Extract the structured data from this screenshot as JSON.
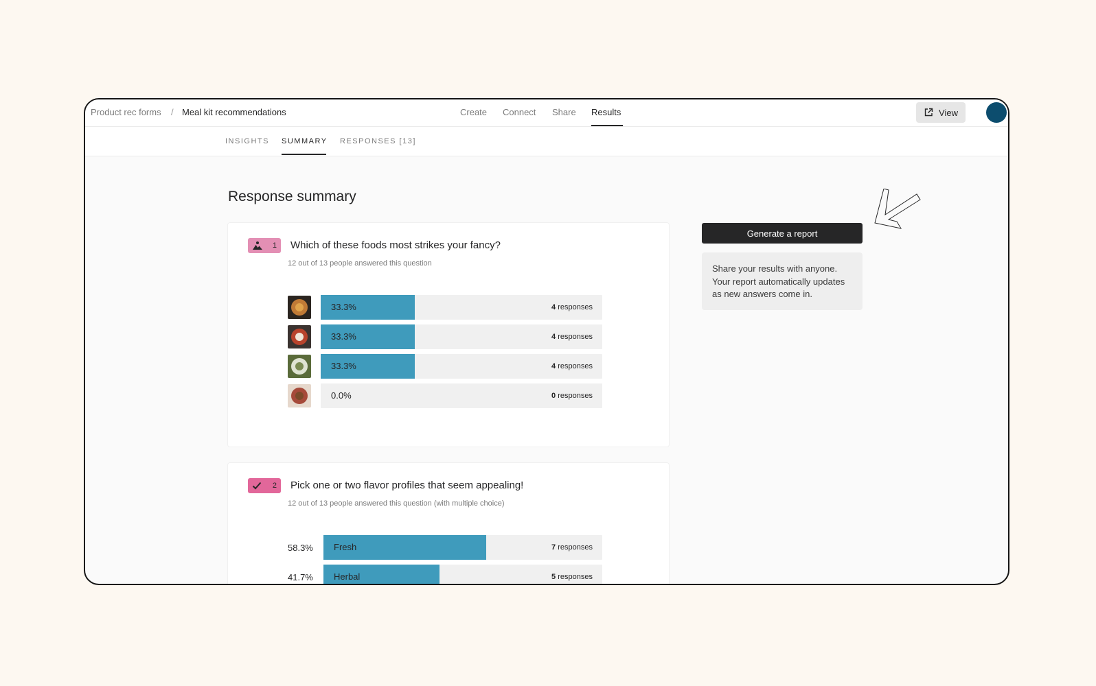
{
  "breadcrumb": {
    "parent": "Product rec forms",
    "separator": "/",
    "current": "Meal kit recommendations"
  },
  "nav_tabs": [
    {
      "label": "Create",
      "active": false
    },
    {
      "label": "Connect",
      "active": false
    },
    {
      "label": "Share",
      "active": false
    },
    {
      "label": "Results",
      "active": true
    }
  ],
  "view_button": {
    "label": "View",
    "icon": "external-link-icon"
  },
  "avatar": {
    "color": "#0c4d6e"
  },
  "sub_tabs": [
    {
      "label": "INSIGHTS",
      "active": false
    },
    {
      "label": "SUMMARY",
      "active": true
    },
    {
      "label": "RESPONSES [13]",
      "active": false
    }
  ],
  "page_title": "Response summary",
  "questions": [
    {
      "number": "1",
      "icon": "picture-choice-icon",
      "badge_color": "#e38fb4",
      "title": "Which of these foods most strikes your fancy?",
      "subtitle": "12 out of 13 people answered this question",
      "answers": [
        {
          "thumb": "food-image-1",
          "percent": "33.3%",
          "fraction": 0.333,
          "count": "4",
          "unit": "responses"
        },
        {
          "thumb": "food-image-2",
          "percent": "33.3%",
          "fraction": 0.333,
          "count": "4",
          "unit": "responses"
        },
        {
          "thumb": "food-image-3",
          "percent": "33.3%",
          "fraction": 0.333,
          "count": "4",
          "unit": "responses"
        },
        {
          "thumb": "food-image-4",
          "percent": "0.0%",
          "fraction": 0.0,
          "count": "0",
          "unit": "responses"
        }
      ]
    },
    {
      "number": "2",
      "icon": "checkmark-icon",
      "badge_color": "#e2679a",
      "title": "Pick one or two flavor profiles that seem appealing!",
      "subtitle": "12 out of 13 people answered this question (with multiple choice)",
      "answers": [
        {
          "label": "Fresh",
          "percent": "58.3%",
          "fraction": 0.583,
          "count": "7",
          "unit": "responses"
        },
        {
          "label": "Herbal",
          "percent": "41.7%",
          "fraction": 0.417,
          "count": "5",
          "unit": "responses"
        }
      ]
    }
  ],
  "report": {
    "button_label": "Generate a report",
    "info_text": "Share your results with anyone. Your report automatically updates as new answers come in."
  },
  "colors": {
    "bar_fill": "#3f9bbc",
    "bar_track": "#f0f0f0",
    "page_background": "#fdf8f1"
  }
}
